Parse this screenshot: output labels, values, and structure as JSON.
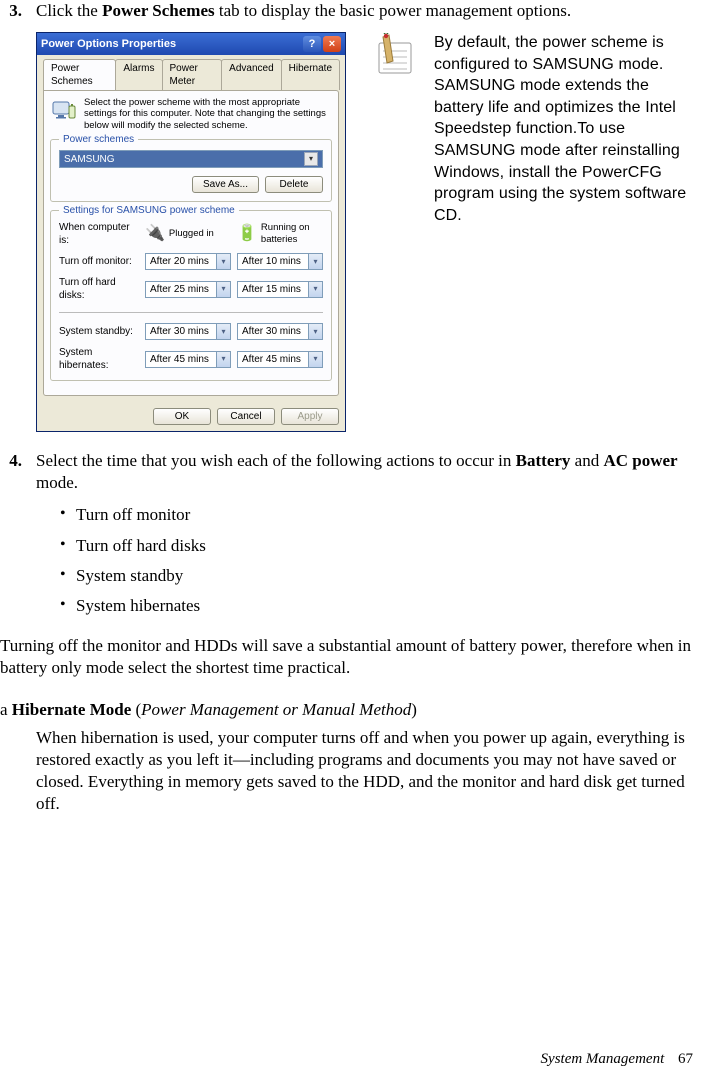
{
  "step3": {
    "num": "3.",
    "pre": "Click the ",
    "bold": "Power Schemes",
    "post": " tab to display the basic power management options."
  },
  "dialog": {
    "title": "Power Options Properties",
    "help": "?",
    "close": "×",
    "tabs": [
      "Power Schemes",
      "Alarms",
      "Power Meter",
      "Advanced",
      "Hibernate"
    ],
    "desc": "Select the power scheme with the most appropriate settings for this computer. Note that changing the settings below will modify the selected scheme.",
    "group_schemes": "Power schemes",
    "scheme_value": "SAMSUNG",
    "save_as": "Save As...",
    "delete": "Delete",
    "group_settings": "Settings for SAMSUNG power scheme",
    "when_label": "When computer is:",
    "plugged": "Plugged in",
    "batteries": "Running on batteries",
    "rows": {
      "monitor": {
        "label": "Turn off monitor:",
        "plugged": "After 20 mins",
        "batt": "After 10 mins"
      },
      "disks": {
        "label": "Turn off hard disks:",
        "plugged": "After 25 mins",
        "batt": "After 15 mins"
      },
      "standby": {
        "label": "System standby:",
        "plugged": "After 30 mins",
        "batt": "After 30 mins"
      },
      "hiber": {
        "label": "System hibernates:",
        "plugged": "After 45 mins",
        "batt": "After 45 mins"
      }
    },
    "ok": "OK",
    "cancel": "Cancel",
    "apply": "Apply"
  },
  "note": "By default, the power scheme is configured to SAMSUNG mode. SAMSUNG mode extends the battery life and optimizes the Intel Speedstep function.To use SAMSUNG mode after reinstalling Windows, install the PowerCFG program using the system software CD.",
  "step4": {
    "num": "4.",
    "pre": "Select the time that you wish each of the following actions to occur in ",
    "b1": "Battery",
    "mid": " and ",
    "b2": "AC power",
    "post": " mode."
  },
  "bullets": [
    "Turn off monitor",
    "Turn off hard disks",
    "System standby",
    "System hibernates"
  ],
  "para1": "Turning off the monitor and HDDs will save a substantial amount of battery power, therefore when in battery only mode select the shortest time practical.",
  "hib_head": {
    "a": "a ",
    "b": "Hibernate Mode ",
    "c": "(",
    "i": "Power Management or Manual Method",
    "d": ")"
  },
  "hib_body": "When hibernation is used, your computer turns off and when you power up again, everything is restored exactly as you left it—including programs and documents you may not have saved or closed. Everything in memory gets saved to the HDD, and the monitor and hard disk get turned off.",
  "footer": {
    "section": "System Management",
    "page": "67"
  }
}
